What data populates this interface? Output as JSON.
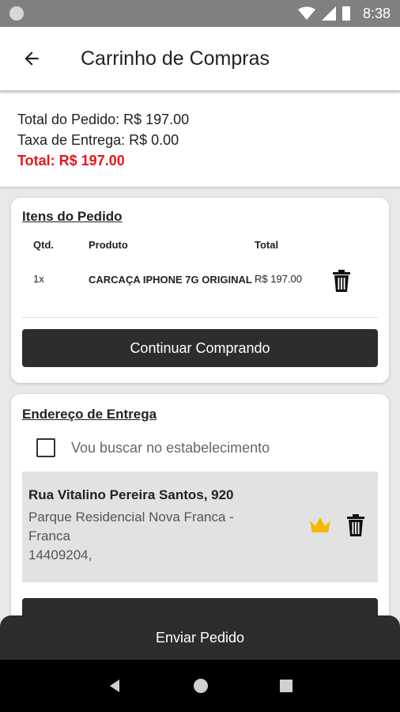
{
  "status_bar": {
    "time": "8:38"
  },
  "app_bar": {
    "title": "Carrinho de Compras"
  },
  "summary": {
    "order_total": "Total do Pedido: R$ 197.00",
    "delivery_fee": "Taxa de Entrega: R$ 0.00",
    "grand_total": "Total: R$ 197.00"
  },
  "items_card": {
    "title": "Itens do Pedido",
    "columns": [
      "Qtd.",
      "Produto",
      "Total"
    ],
    "rows": [
      {
        "qty": "1x",
        "product": "CARCAÇA IPHONE 7G ORIGINAL",
        "total": "R$ 197.00"
      }
    ],
    "continue_button": "Continuar Comprando"
  },
  "address_card": {
    "title": "Endereço de Entrega",
    "pickup_label": "Vou buscar no estabelecimento",
    "pickup_checked": false,
    "address": {
      "street": "Rua Vitalino Pereira Santos, 920",
      "line1": "Parque Residencial Nova Franca -",
      "line2": "Franca",
      "zip": "14409204,"
    }
  },
  "send_button": "Enviar Pedido",
  "colors": {
    "accent_red": "#e8141d",
    "dark_button": "#2d2d30",
    "crown": "#f5b800"
  }
}
